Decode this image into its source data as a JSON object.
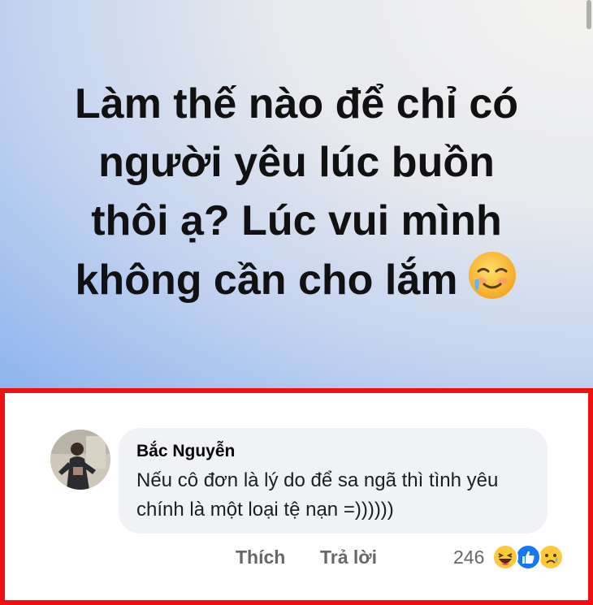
{
  "post": {
    "lines": [
      "Làm thế nào để chỉ có",
      "người yêu lúc buồn",
      "thôi ạ? Lúc vui mình",
      "không cần cho lắm"
    ],
    "emoji": "sweat-smile-tear-icon"
  },
  "comment": {
    "author": "Bắc Nguyễn",
    "text": "Nếu cô đơn là lý do để sa ngã thì tình yêu chính là một loại tệ nạn =))))))",
    "actions": {
      "like": "Thích",
      "reply": "Trả lời"
    },
    "reaction_count": "246",
    "reaction_icons": [
      "haha-icon",
      "like-icon",
      "sad-icon"
    ]
  },
  "colors": {
    "highlight_border": "#ee1111",
    "bubble": "#f0f2f5",
    "action_text": "#65676b",
    "like_blue": "#1877f2"
  }
}
